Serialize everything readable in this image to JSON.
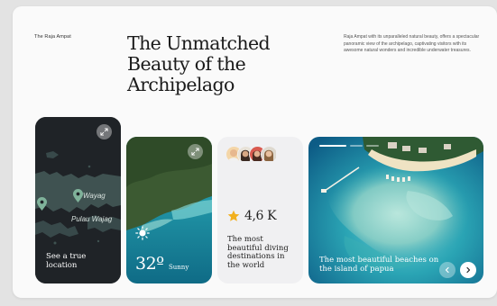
{
  "header": {
    "brand": "The Raja Ampat",
    "headline_lines": [
      "The Unmatched",
      "Beauty of the",
      "Archipelago"
    ],
    "description": "Raja Ampat with its unparalleled natural beauty, offers a spectacular panoramic view of the archipelago, captivating visitors with its awesome natural wonders and incredible underwater treasures."
  },
  "cards": {
    "map": {
      "places": [
        "Wayag",
        "Pulau Wajag"
      ],
      "caption": "See a true location",
      "icons": [
        "expand-icon",
        "map-pin-icon"
      ]
    },
    "weather": {
      "temperature": "32º",
      "condition": "Sunny",
      "icons": [
        "expand-icon",
        "sun-icon"
      ]
    },
    "rating": {
      "value": "4,6 K",
      "caption": "The most beautiful diving destinations in the world",
      "avatar_count": 4,
      "icons": [
        "star-icon"
      ]
    },
    "island": {
      "caption": "The most beautiful beaches on the island of papua",
      "slide_count": 3,
      "active_slide": 1,
      "icons": [
        "chevron-left-icon",
        "chevron-right-icon"
      ]
    }
  },
  "colors": {
    "page_bg": "#e3e3e3",
    "panel_bg": "#fafafa",
    "map_card": "#1f2327",
    "rating_card": "#f0f0f2",
    "star": "#f2b01e",
    "sea": "#1b9fb4"
  }
}
